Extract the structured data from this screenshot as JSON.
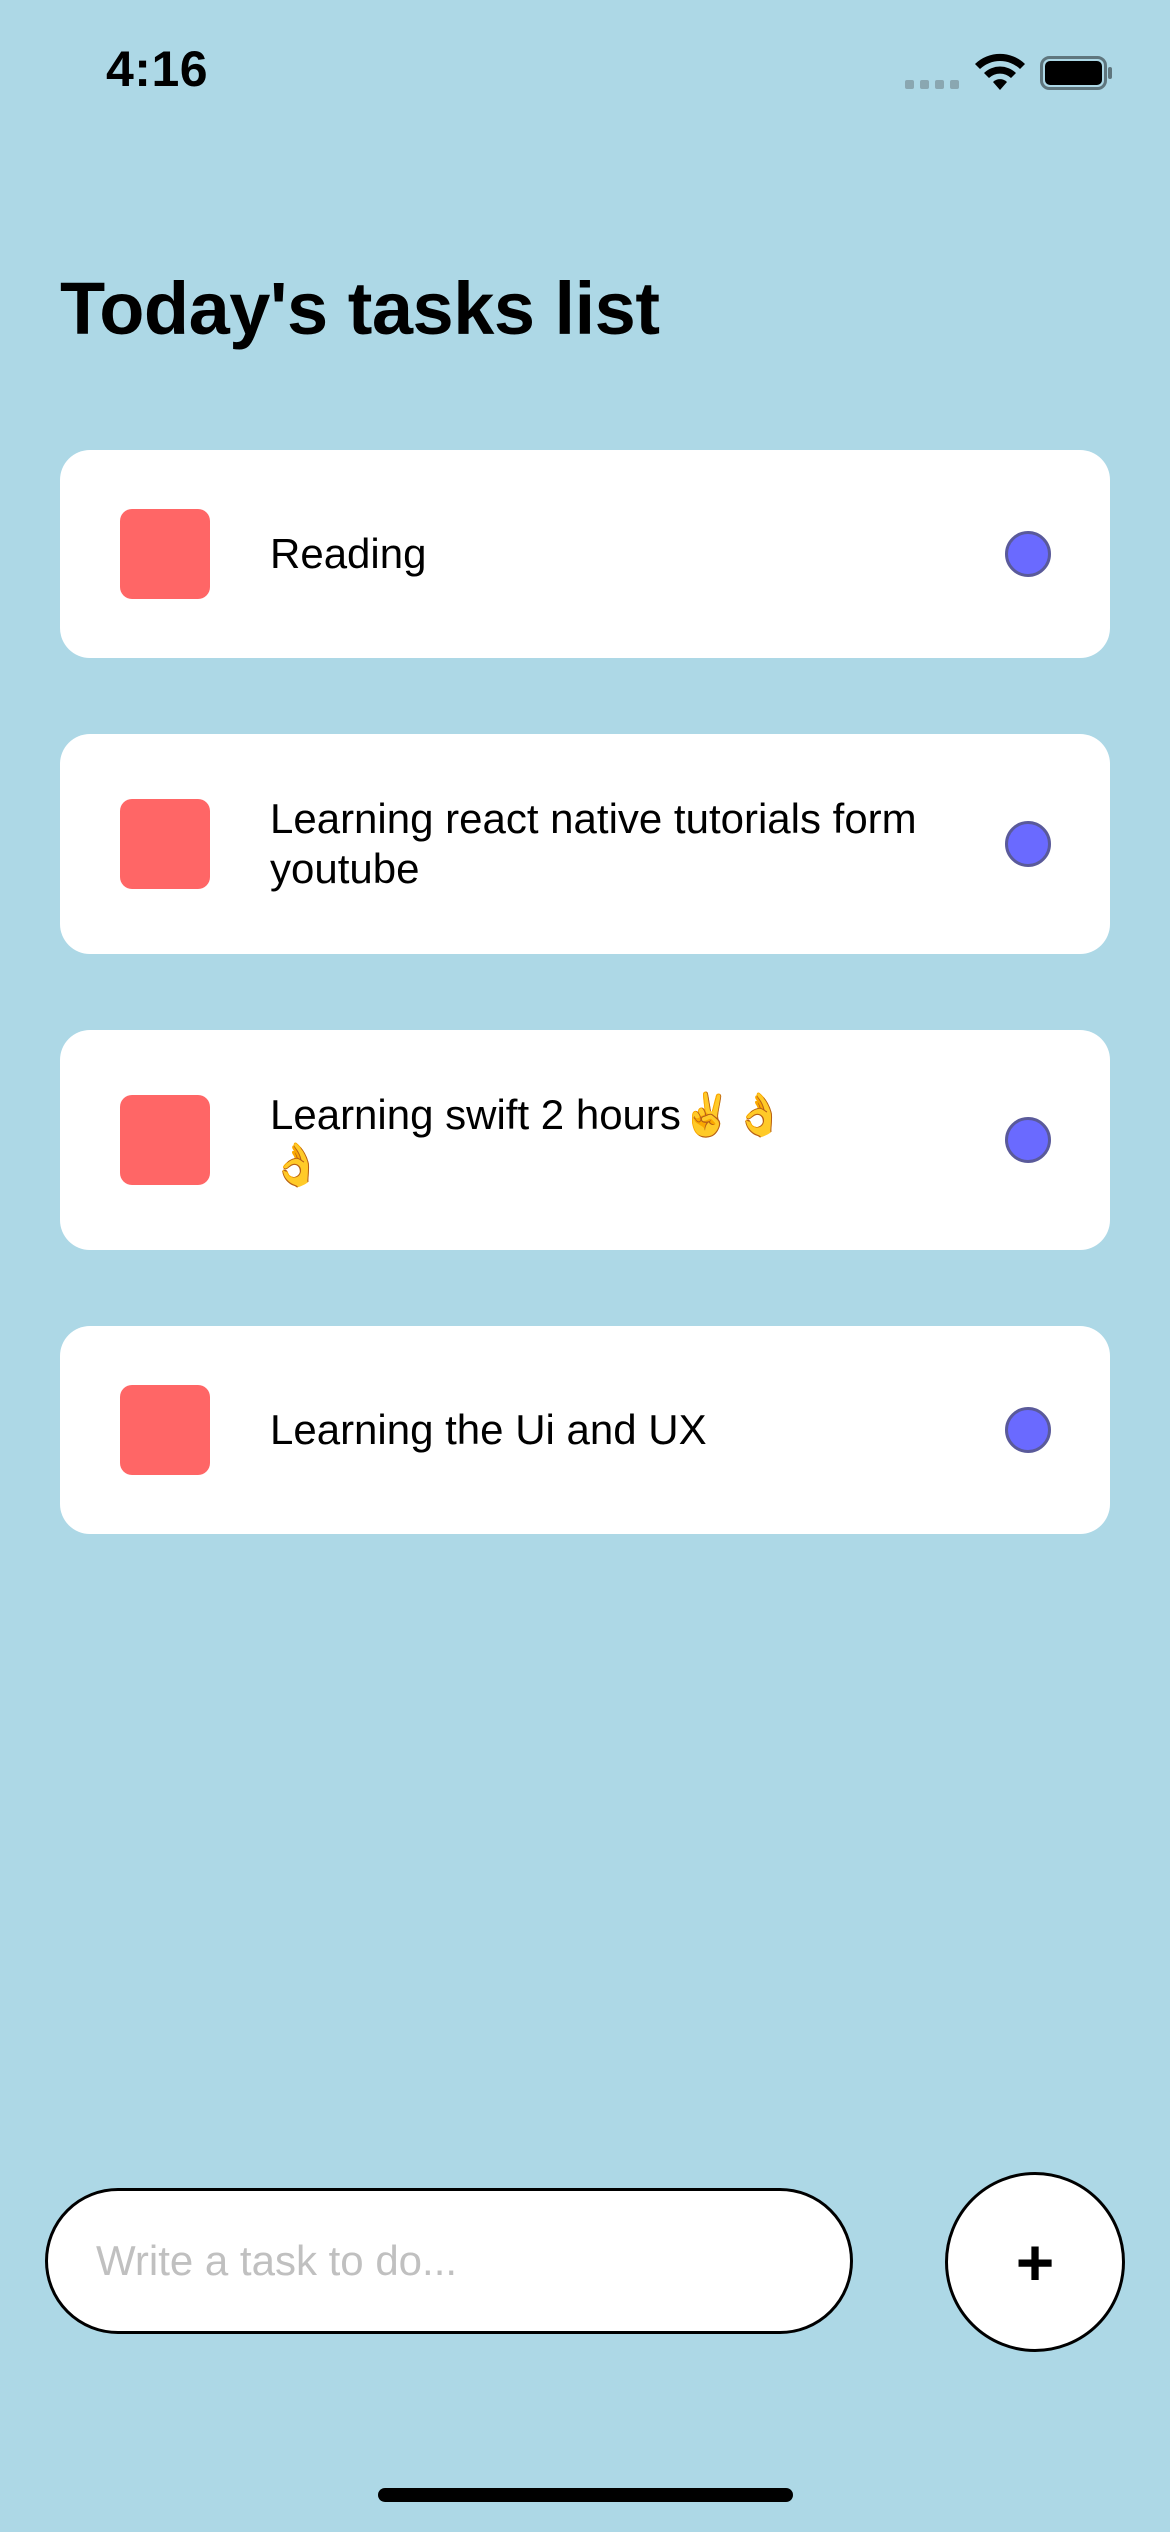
{
  "status_bar": {
    "time": "4:16",
    "icons": [
      "cellular-signal-icon",
      "wifi-icon",
      "battery-icon"
    ]
  },
  "header": {
    "title": "Today's tasks list"
  },
  "tasks": [
    {
      "text": "Reading"
    },
    {
      "text": "Learning react native tutorials form youtube"
    },
    {
      "text": "Learning swift 2 hours✌️👌👌"
    },
    {
      "text": "Learning the Ui and UX"
    }
  ],
  "composer": {
    "placeholder": "Write a task to do...",
    "value": "",
    "add_label": "+"
  },
  "colors": {
    "background": "#add8e6",
    "card": "#ffffff",
    "task_square": "#ff6666",
    "task_circle": "#6a6aff",
    "text": "#000000",
    "placeholder": "#c0c0c0"
  }
}
